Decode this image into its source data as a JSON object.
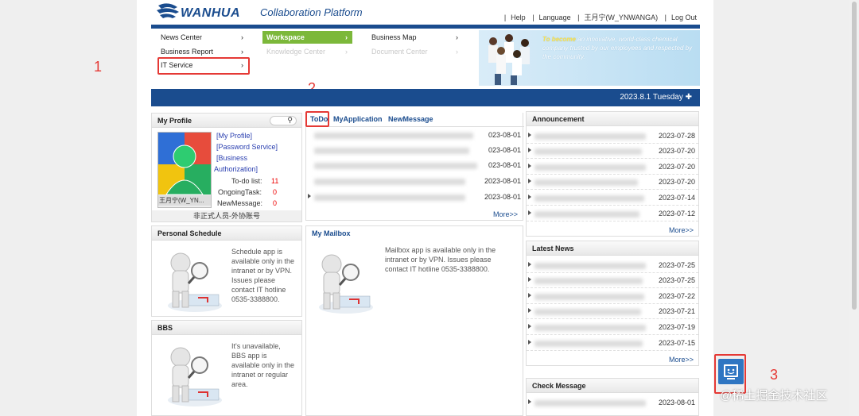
{
  "header": {
    "logo_text": "WANHUA",
    "platform_title": "Collaboration Platform",
    "links": [
      "Help",
      "Language",
      "王月宁(W_YNWANGA)",
      "Log Out"
    ]
  },
  "menu": {
    "col1": [
      {
        "label": "News Center"
      },
      {
        "label": "Business Report"
      },
      {
        "label": "IT Service"
      }
    ],
    "col2": [
      {
        "label": "Workspace"
      },
      {
        "label": "Knowledge Center"
      }
    ],
    "col3": [
      {
        "label": "Business Map"
      },
      {
        "label": "Document Center"
      }
    ]
  },
  "banner": {
    "text_emph": "To become",
    "text_rest": " an innovative, world-class chemical company trusted by our employees and respected by the community."
  },
  "date_bar": "2023.8.1 Tuesday",
  "profile": {
    "title": "My Profile",
    "links": [
      "[My Profile]",
      "[Password Service]",
      "[Business",
      "Authorization]"
    ],
    "todo_label": "To-do list:",
    "todo_count": "11",
    "ongoing_label": "OngoingTask:",
    "ongoing_count": "0",
    "newmsg_label": "NewMessage:",
    "newmsg_count": "0",
    "name": "王月宁(W_YN...",
    "role": "非正式人员-外协账号"
  },
  "todo": {
    "tabs": [
      "ToDo",
      "MyApplication",
      "NewMessage"
    ],
    "dates": [
      "023-08-01",
      "023-08-01",
      "023-08-01",
      "2023-08-01",
      "2023-08-01"
    ],
    "more": "More>>"
  },
  "announcement": {
    "title": "Announcement",
    "dates": [
      "2023-07-28",
      "2023-07-20",
      "2023-07-20",
      "2023-07-20",
      "2023-07-14",
      "2023-07-12"
    ],
    "more": "More>>"
  },
  "latest_news": {
    "title": "Latest News",
    "dates": [
      "2023-07-25",
      "2023-07-25",
      "2023-07-22",
      "2023-07-21",
      "2023-07-19",
      "2023-07-15"
    ],
    "more": "More>>"
  },
  "check_message": {
    "title": "Check Message",
    "dates": [
      "2023-08-01"
    ]
  },
  "personal_schedule": {
    "title": "Personal Schedule",
    "text": "Schedule app is available only in the intranet or by VPN. Issues please contact IT hotline 0535-3388800."
  },
  "mailbox": {
    "title": "My Mailbox",
    "text": "Mailbox app is available only in the intranet or by VPN. Issues please contact IT hotline 0535-3388800."
  },
  "bbs": {
    "title": "BBS",
    "text": "It's unavailable, BBS app is available only in the intranet or regular area."
  },
  "annotations": [
    "1",
    "2",
    "3"
  ],
  "watermark": "@稀土掘金技术社区",
  "colors": {
    "brand": "#1a4c8e",
    "accent": "#7cb83a",
    "highlight": "#e53935"
  }
}
